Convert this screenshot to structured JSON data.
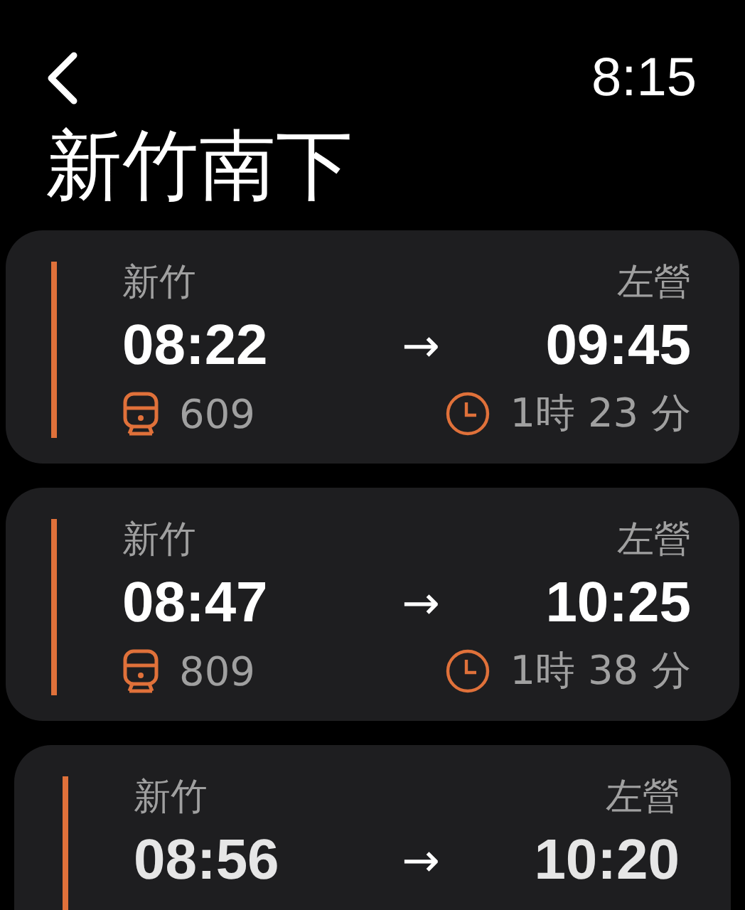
{
  "header": {
    "time": "8:15",
    "title": "新竹南下"
  },
  "trips": [
    {
      "from": "新竹",
      "to": "左營",
      "depart": "08:22",
      "arrow": "→",
      "arrive": "09:45",
      "train": "609",
      "duration": "1時 23 分"
    },
    {
      "from": "新竹",
      "to": "左營",
      "depart": "08:47",
      "arrow": "→",
      "arrive": "10:25",
      "train": "809",
      "duration": "1時 38 分"
    },
    {
      "from": "新竹",
      "to": "左營",
      "depart": "08:56",
      "arrow": "→",
      "arrive": "10:20"
    }
  ]
}
